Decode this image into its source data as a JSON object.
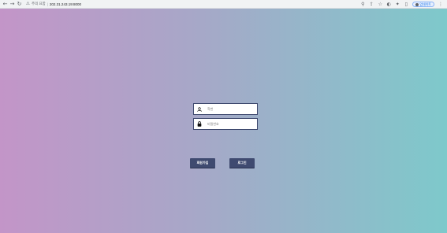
{
  "browser": {
    "security_label": "주의 요함",
    "url": "202.31.243.19:8000",
    "update_label": "업데이트"
  },
  "login": {
    "id_placeholder": "학번",
    "password_placeholder": "비밀번호",
    "signup_label": "회원가입",
    "login_label": "로그인"
  },
  "colors": {
    "gradient_left": "#c395c8",
    "gradient_right": "#7ec9cb",
    "button": "#3f4a70"
  }
}
